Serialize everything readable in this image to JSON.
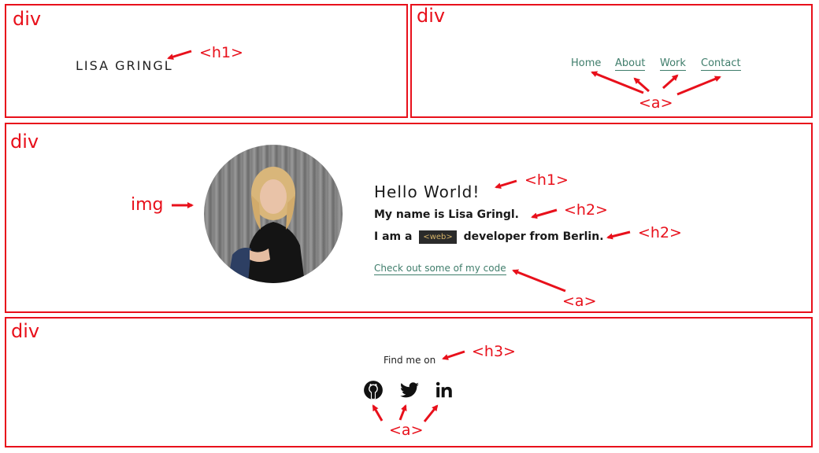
{
  "labels": {
    "div_header_left": "div",
    "div_header_right": "div",
    "div_main": "div",
    "div_footer": "div",
    "h1_brand": "<h1>",
    "a_nav": "<a>",
    "img": "img",
    "h1_hello": "<h1>",
    "h2_name": "<h2>",
    "h2_role": "<h2>",
    "a_code": "<a>",
    "h3_find": "<h3>",
    "a_social": "<a>"
  },
  "header": {
    "brand": "LISA GRINGL"
  },
  "nav": {
    "home": "Home",
    "about": "About",
    "work": "Work",
    "contact": "Contact"
  },
  "hero": {
    "hello": "Hello World!",
    "name_line": "My name is Lisa Gringl.",
    "role_prefix": "I am a",
    "role_chip": "<web>",
    "role_suffix": "developer from Berlin.",
    "code_link": "Check out some of my code"
  },
  "footer": {
    "find_me": "Find me on",
    "icons": [
      "github-icon",
      "twitter-icon",
      "linkedin-icon"
    ]
  },
  "colors": {
    "annotation": "#e8101b",
    "link": "#3f7d6b",
    "chip_bg": "#2a2a2a",
    "chip_text": "#d6b46a"
  }
}
